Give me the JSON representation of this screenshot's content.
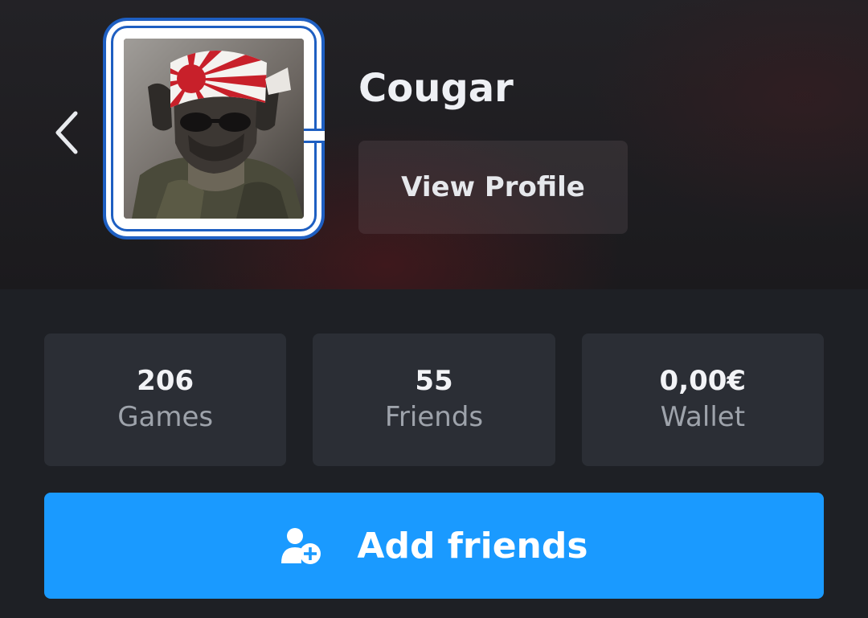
{
  "profile": {
    "username": "Cougar",
    "view_profile_label": "View Profile"
  },
  "stats": [
    {
      "value": "206",
      "label": "Games"
    },
    {
      "value": "55",
      "label": "Friends"
    },
    {
      "value": "0,00€",
      "label": "Wallet"
    }
  ],
  "actions": {
    "add_friends_label": "Add friends"
  },
  "icons": {
    "back": "chevron-left-icon",
    "add_friend": "user-plus-icon"
  },
  "colors": {
    "accent": "#1a9aff",
    "card": "#2b2e35",
    "background": "#1e2025",
    "avatar_frame": "#1e5fc2"
  }
}
